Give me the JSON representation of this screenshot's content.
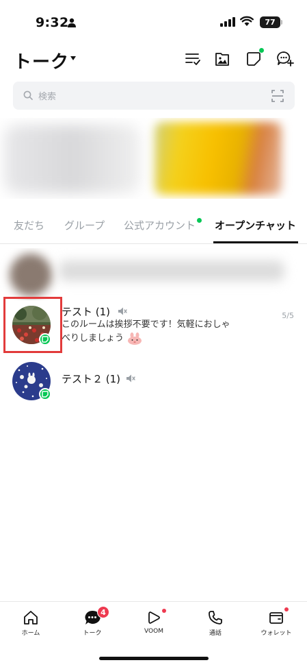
{
  "status_bar": {
    "time": "9:32",
    "battery": "77"
  },
  "header": {
    "title": "トーク",
    "icons": [
      "edit-list-icon",
      "album-icon",
      "voom-story-icon",
      "new-chat-icon"
    ]
  },
  "search": {
    "placeholder": "検索"
  },
  "tabs": [
    {
      "label": "友だち",
      "active": false
    },
    {
      "label": "グループ",
      "active": false
    },
    {
      "label": "公式アカウント",
      "active": false,
      "dot": true
    },
    {
      "label": "オープンチャット",
      "active": true
    }
  ],
  "chats": [
    {
      "name": "テスト (1)",
      "preview": "このルームは挨拶不要です！気軽におしゃべりしましょう",
      "count": "5/5",
      "muted": true
    },
    {
      "name": "テスト２ (1)",
      "preview": "",
      "count": "",
      "muted": true
    }
  ],
  "bottom_nav": [
    {
      "label": "ホーム",
      "icon": "home-icon"
    },
    {
      "label": "トーク",
      "icon": "chat-bubble-icon",
      "badge": "4"
    },
    {
      "label": "VOOM",
      "icon": "voom-icon",
      "dot": true
    },
    {
      "label": "通話",
      "icon": "phone-icon"
    },
    {
      "label": "ウォレット",
      "icon": "wallet-icon",
      "dot": true
    }
  ],
  "colors": {
    "accent_green": "#06c755",
    "badge_red": "#ee3a50",
    "highlight_red": "#e23b3b"
  }
}
